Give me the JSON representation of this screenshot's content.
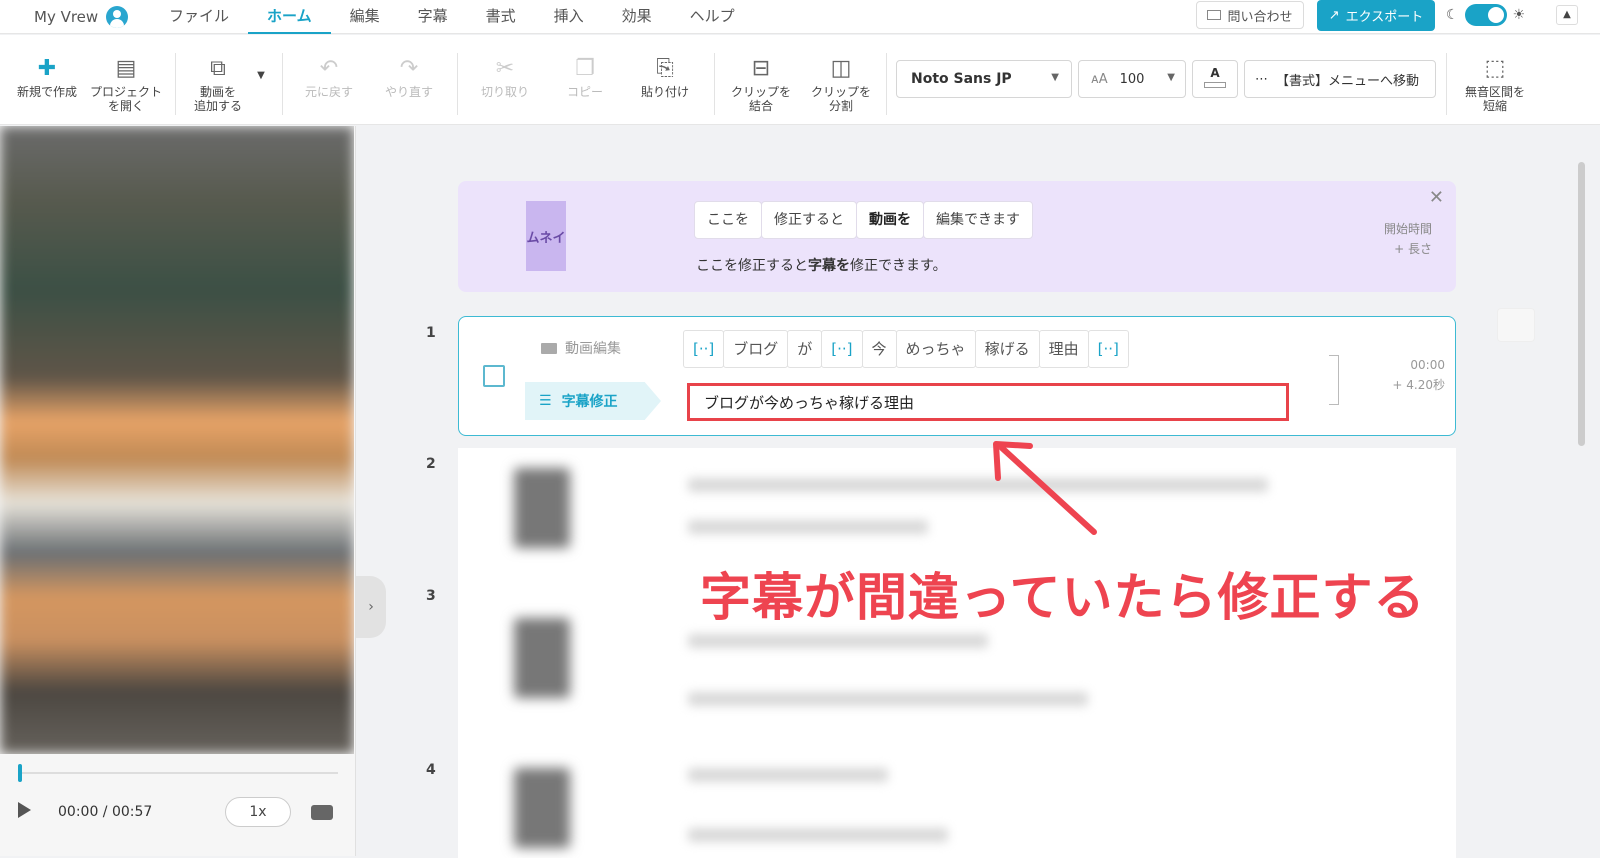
{
  "app": {
    "name": "My Vrew"
  },
  "menus": [
    "ファイル",
    "ホーム",
    "編集",
    "字幕",
    "書式",
    "挿入",
    "効果",
    "ヘルプ"
  ],
  "menu_active": "ホーム",
  "header": {
    "contact_label": "問い合わせ",
    "export_label": "エクスポート"
  },
  "toolbar": {
    "new": "新規で作成",
    "open_l1": "プロジェクト",
    "open_l2": "を開く",
    "add_l1": "動画を",
    "add_l2": "追加する",
    "undo": "元に戻す",
    "redo": "やり直す",
    "cut": "切り取り",
    "copy": "コピー",
    "paste": "貼り付け",
    "merge_l1": "クリップを",
    "merge_l2": "結合",
    "split_l1": "クリップを",
    "split_l2": "分割",
    "font": "Noto Sans JP",
    "font_size": "100",
    "color_letter": "A",
    "format_menu": "【書式】メニューへ移動",
    "silence_l1": "無音区間を",
    "silence_l2": "短縮"
  },
  "player": {
    "time": "00:00 / 00:57",
    "speed": "1x",
    "progress_fraction": 0.0
  },
  "tip": {
    "thumb": "ムネイ",
    "words": [
      "ここを",
      "修正すると",
      "動画を",
      "編集できます"
    ],
    "desc_pre": "ここを修正すると",
    "desc_bold": "字幕を",
    "desc_post": "修正できます。",
    "meta_l1": "開始時間",
    "meta_l2": "+ 長さ"
  },
  "rows": [
    "1",
    "2",
    "3",
    "4"
  ],
  "clip": {
    "edit_label": "動画編集",
    "subtitle_label": "字幕修正",
    "tokens": [
      "[··]",
      "ブログ",
      "が",
      "[··]",
      "今",
      "めっちゃ",
      "稼げる",
      "理由",
      "[··]"
    ],
    "subtitle_text": "ブログが今めっちゃ稼げる理由",
    "start": "00:00",
    "length": "+ 4.20秒"
  },
  "annotation": "字幕が間違っていたら修正する",
  "colors": {
    "accent": "#1aa3c7",
    "annotation": "#ee4450",
    "tip_bg": "#ece3fb"
  }
}
